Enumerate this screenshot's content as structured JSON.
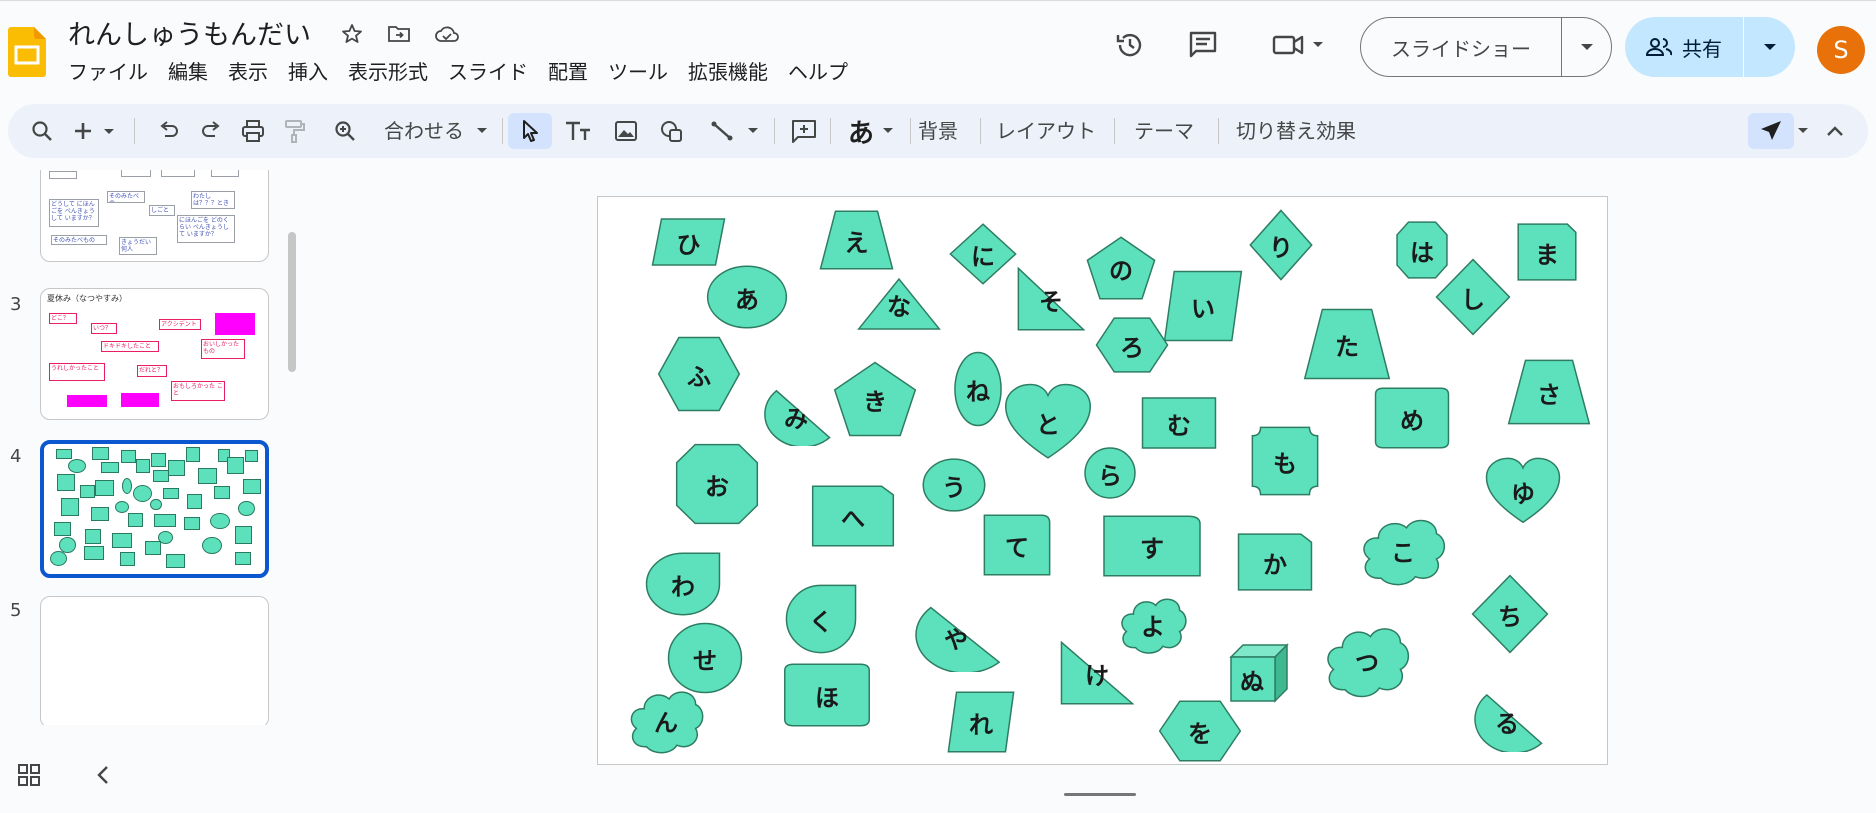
{
  "doc": {
    "title": "れんしゅうもんだい"
  },
  "menu": [
    "ファイル",
    "編集",
    "表示",
    "挿入",
    "表示形式",
    "スライド",
    "配置",
    "ツール",
    "拡張機能",
    "ヘルプ"
  ],
  "header": {
    "slideshow_label": "スライドショー",
    "share_label": "共有",
    "avatar_initial": "S"
  },
  "toolbar": {
    "zoom_label": "合わせる",
    "background": "背景",
    "layout": "レイアウト",
    "theme": "テーマ",
    "transition": "切り替え効果"
  },
  "filmstrip": {
    "slides": [
      {
        "number": "3",
        "title": "夏休み（なつやすみ）"
      },
      {
        "number": "4"
      },
      {
        "number": "5"
      }
    ],
    "slide2_boxes": [
      "どうして にほんごを べんきょうして いますか？",
      "そのみたべの",
      "しごと",
      "わたし は？？？とき",
      "にほんごを どのくらい べんきょうして いますか？",
      "そのみたべもの",
      "きょうだい 何人"
    ],
    "slide3_boxes": [
      "どこ？",
      "いつ？",
      "アクシデント",
      "ドキドキしたこと",
      "おいしかった もの",
      "うれしかったこと",
      "だれと？",
      "おもしろかった こと"
    ]
  },
  "slide_kana": {
    "hi": "ひ",
    "e": "え",
    "ni": "に",
    "ri": "り",
    "ha": "は",
    "ma": "ま",
    "a": "あ",
    "na": "な",
    "so": "そ",
    "no": "の",
    "i": "い",
    "shi": "し",
    "ro": "ろ",
    "fu": "ふ",
    "ta": "た",
    "sa": "さ",
    "mi": "み",
    "ki": "き",
    "ne": "ね",
    "to": "と",
    "mu": "む",
    "me": "め",
    "mo": "も",
    "ra": "ら",
    "o": "お",
    "u": "う",
    "he": "へ",
    "yu": "ゆ",
    "te": "て",
    "su": "す",
    "wa": "わ",
    "ko": "こ",
    "ka": "か",
    "ku": "く",
    "chi": "ち",
    "yo": "よ",
    "se": "せ",
    "ya": "や",
    "tsu": "つ",
    "ke": "け",
    "nu": "ぬ",
    "ho": "ほ",
    "n": "ん",
    "re": "れ",
    "wo": "を",
    "ru": "る"
  },
  "colors": {
    "shape_fill": "#5ce1bc",
    "shape_stroke": "#2e7d63",
    "accent": "#0b57d0",
    "share_bg": "#c2e7ff",
    "avatar": "#e8710a",
    "magenta": "#ff00ff"
  }
}
